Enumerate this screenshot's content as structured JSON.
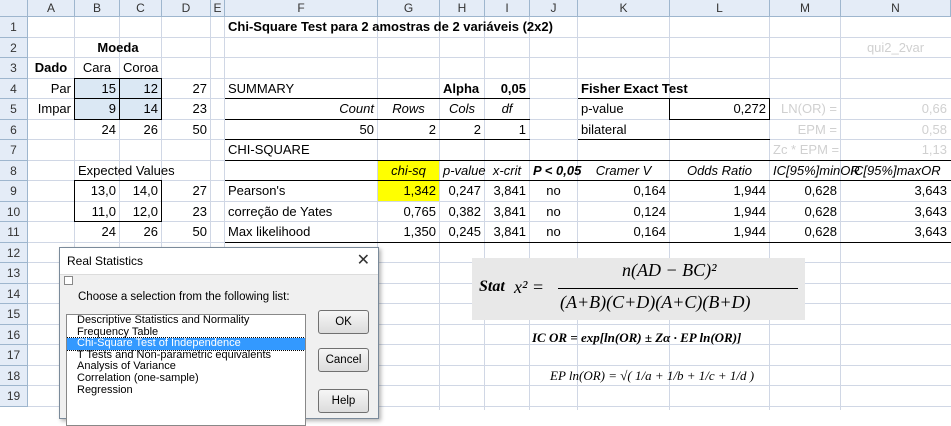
{
  "columns": [
    "A",
    "B",
    "C",
    "D",
    "E",
    "F",
    "G",
    "H",
    "I",
    "J",
    "K",
    "L",
    "M",
    "N"
  ],
  "rows": [
    "1",
    "2",
    "3",
    "4",
    "5",
    "6",
    "7",
    "8",
    "9",
    "10",
    "11",
    "12",
    "13",
    "14",
    "15",
    "16",
    "17",
    "18",
    "19"
  ],
  "sheet": {
    "moeda": "Moeda",
    "dado": "Dado",
    "cara": "Cara",
    "coroa": "Coroa",
    "par": "Par",
    "impar": "Impar",
    "obs": [
      [
        "15",
        "12",
        "27"
      ],
      [
        "9",
        "14",
        "23"
      ],
      [
        "24",
        "26",
        "50"
      ]
    ],
    "expected_label": "Expected Values",
    "exp": [
      [
        "13,0",
        "14,0",
        "27"
      ],
      [
        "11,0",
        "12,0",
        "23"
      ],
      [
        "24",
        "26",
        "50"
      ]
    ],
    "title": "Chi-Square Test para 2 amostras de 2 variáveis (2x2)",
    "name_cell": "qui2_2var",
    "summary": "SUMMARY",
    "alpha_label": "Alpha",
    "alpha": "0,05",
    "fisher": "Fisher Exact Test",
    "count_h": [
      "Count",
      "Rows",
      "Cols",
      "df"
    ],
    "count_v": [
      "50",
      "2",
      "2",
      "1"
    ],
    "pvalue_label": "p-value",
    "pvalue": "0,272",
    "bilateral": "bilateral",
    "chisquare": "CHI-SQUARE",
    "gray_labels": [
      "LN(OR) =",
      "EPM =",
      "Zc * EPM ="
    ],
    "gray_values": [
      "0,66",
      "0,58",
      "1,13"
    ],
    "res_headers": [
      "chi-sq",
      "p-value",
      "x-crit",
      "P < 0,05",
      "Cramer V",
      "Odds Ratio",
      "IC[95%]minOR",
      "IC[95%]maxOR"
    ],
    "res_rows": [
      {
        "name": "Pearson's",
        "vals": [
          "1,342",
          "0,247",
          "3,841",
          "no",
          "0,164",
          "1,944",
          "0,628",
          "3,643"
        ]
      },
      {
        "name": "correção de Yates",
        "vals": [
          "0,765",
          "0,382",
          "3,841",
          "no",
          "0,124",
          "1,944",
          "0,628",
          "3,643"
        ]
      },
      {
        "name": "Max likelihood",
        "vals": [
          "1,350",
          "0,245",
          "3,841",
          "no",
          "0,164",
          "1,944",
          "0,628",
          "3,643"
        ]
      }
    ]
  },
  "dialog": {
    "title": "Real Statistics",
    "close": "✕",
    "prompt": "Choose a selection from the following list:",
    "items": [
      "Descriptive Statistics and Normality",
      "Frequency Table",
      "Chi-Square Test of Independence",
      "T Tests and Non-parametric equivalents",
      "Analysis of Variance",
      "Correlation (one-sample)",
      "Regression"
    ],
    "selected_index": 2,
    "ok": "OK",
    "cancel": "Cancel",
    "help": "Help"
  },
  "formula": {
    "stat": "Stat",
    "lhs": "x² =",
    "num": "n(AD − BC)²",
    "den": "(A+B)(C+D)(A+C)(B+D)",
    "ic": "IC OR = exp[ln(OR) ± Zα · EP ln(OR)]",
    "ep": "EP ln(OR) = √( 1/a + 1/b + 1/c + 1/d )"
  }
}
